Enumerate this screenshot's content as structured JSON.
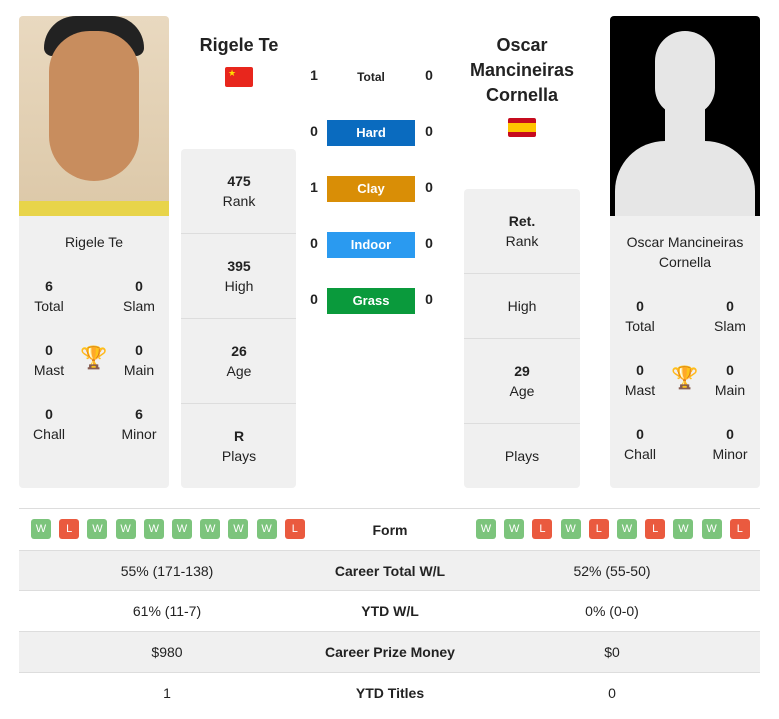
{
  "colors": {
    "hard": "#0a6bbf",
    "clay": "#d98e06",
    "indoor": "#2a9af0",
    "grass": "#0a9a3c",
    "win": "#7cc47c",
    "loss": "#ea5a3f",
    "card": "#f0f0f0"
  },
  "player1": {
    "name": "Rigele Te",
    "flag": "china-flag",
    "total": "6",
    "total_label": "Total",
    "slam": "0",
    "slam_label": "Slam",
    "mast": "0",
    "mast_label": "Mast",
    "main": "0",
    "main_label": "Main",
    "chall": "0",
    "chall_label": "Chall",
    "minor": "6",
    "minor_label": "Minor",
    "rank": "475",
    "rank_label": "Rank",
    "high": "395",
    "high_label": "High",
    "age": "26",
    "age_label": "Age",
    "plays": "R",
    "plays_label": "Plays",
    "form": [
      "W",
      "L",
      "W",
      "W",
      "W",
      "W",
      "W",
      "W",
      "W",
      "L"
    ]
  },
  "player2": {
    "name_lines": [
      "Oscar",
      "Mancineiras",
      "Cornella"
    ],
    "name": "Oscar Mancineiras Cornella",
    "flag": "spain-flag",
    "total": "0",
    "total_label": "Total",
    "slam": "0",
    "slam_label": "Slam",
    "mast": "0",
    "mast_label": "Mast",
    "main": "0",
    "main_label": "Main",
    "chall": "0",
    "chall_label": "Chall",
    "minor": "0",
    "minor_label": "Minor",
    "rank": "Ret.",
    "rank_label": "Rank",
    "high_label": "High",
    "age": "29",
    "age_label": "Age",
    "plays_label": "Plays",
    "form": [
      "W",
      "W",
      "L",
      "W",
      "L",
      "W",
      "L",
      "W",
      "W",
      "L"
    ]
  },
  "h2h": [
    {
      "label": "Total",
      "p1": "1",
      "p2": "0"
    },
    {
      "label": "Hard",
      "p1": "0",
      "p2": "0"
    },
    {
      "label": "Clay",
      "p1": "1",
      "p2": "0"
    },
    {
      "label": "Indoor",
      "p1": "0",
      "p2": "0"
    },
    {
      "label": "Grass",
      "p1": "0",
      "p2": "0"
    }
  ],
  "table": {
    "form_label": "Form",
    "rows": [
      {
        "label": "Career Total W/L",
        "p1": "55% (171-138)",
        "p2": "52% (55-50)"
      },
      {
        "label": "YTD W/L",
        "p1": "61% (11-7)",
        "p2": "0% (0-0)"
      },
      {
        "label": "Career Prize Money",
        "p1": "$980",
        "p2": "$0"
      },
      {
        "label": "YTD Titles",
        "p1": "1",
        "p2": "0"
      }
    ]
  }
}
